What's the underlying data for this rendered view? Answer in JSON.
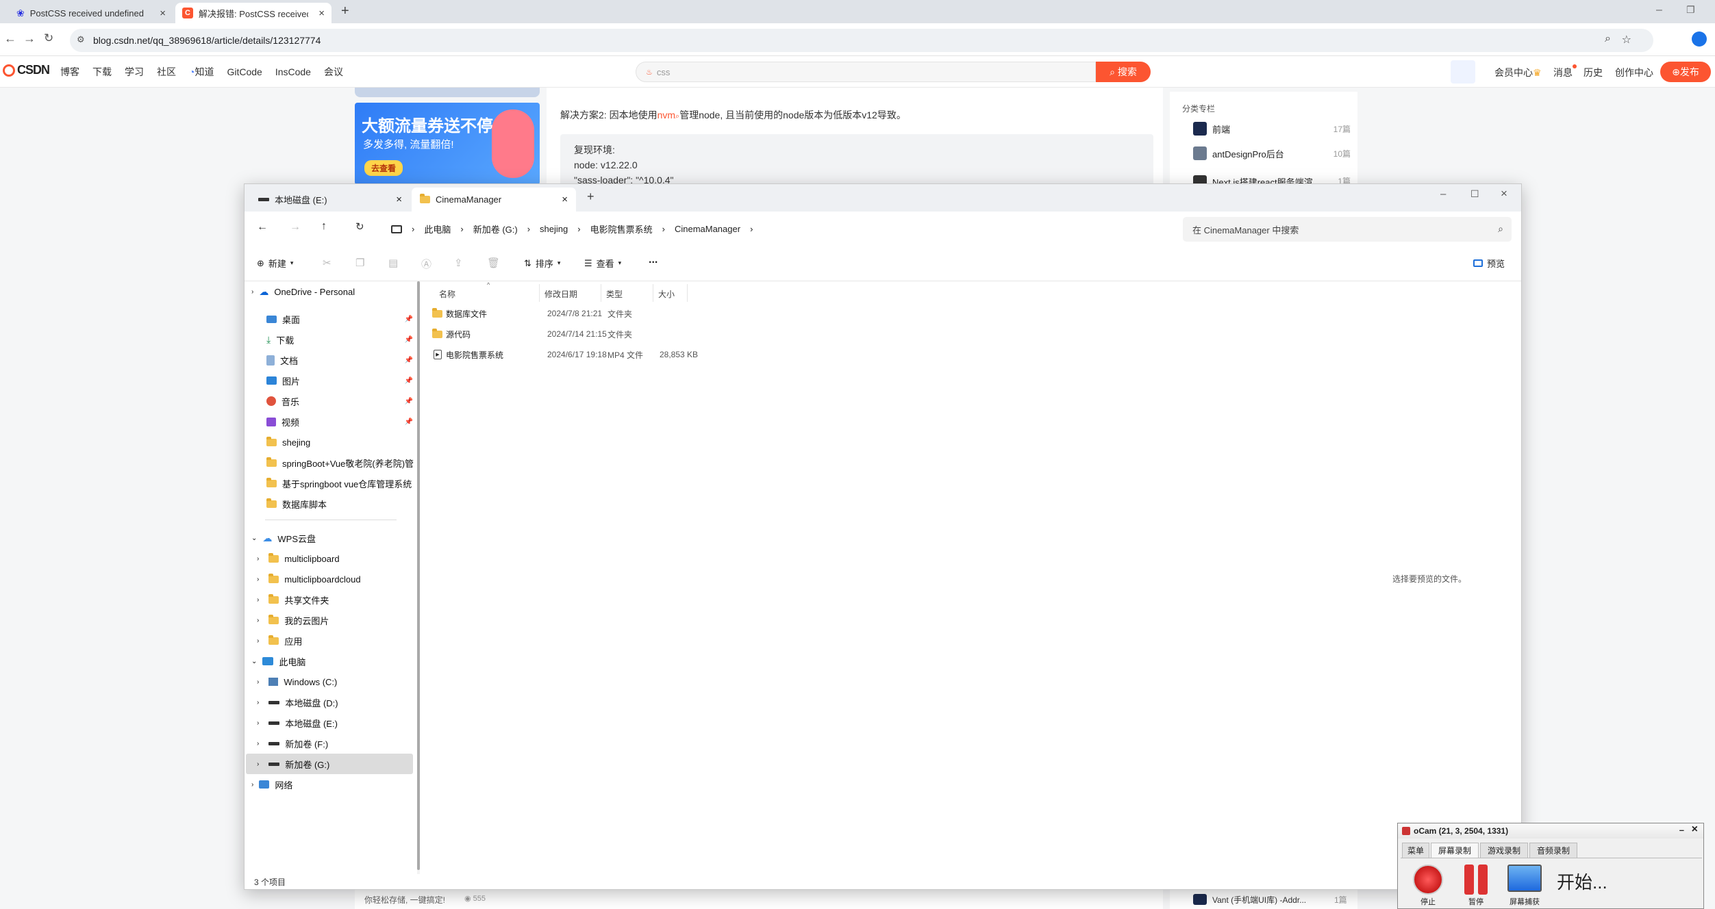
{
  "browser": {
    "tabs": [
      {
        "title": "PostCSS received undefined i",
        "active": false
      },
      {
        "title": "解决报错: PostCSS received u",
        "active": true
      }
    ],
    "url": "blog.csdn.net/qq_38969618/article/details/123127774"
  },
  "csdn": {
    "logo": "CSDN",
    "nav": [
      "博客",
      "下载",
      "学习",
      "社区",
      "知道",
      "GitCode",
      "InsCode",
      "会议"
    ],
    "search_placeholder": "css",
    "search_button": "搜索",
    "right_nav": [
      "会员中心",
      "消息",
      "历史",
      "创作中心"
    ],
    "publish": "发布"
  },
  "article": {
    "ad_title": "大额流量券送不停",
    "ad_subtitle": "多发多得, 流量翻倍!",
    "ad_button": "去查看",
    "solution_prefix": "解决方案2: 因本地使用",
    "solution_link": "nvm",
    "solution_suffix": "管理node, 且当前使用的node版本为低版本v12导致。",
    "code_lines": [
      "复现环境:",
      "node: v12.22.0",
      "\"sass-loader\": \"^10.0.4\""
    ],
    "bottom_text": "你轻松存储, 一键搞定!",
    "bottom_count": "555"
  },
  "column": {
    "title": "分类专栏",
    "items": [
      {
        "name": "前端",
        "count": "17篇"
      },
      {
        "name": "antDesignPro后台",
        "count": "10篇"
      },
      {
        "name": "Next.js搭建react服务端渲",
        "count": "1篇"
      }
    ],
    "bottom_item": {
      "name": "Vant (手机端UI库) -Addr...",
      "count": "1篇"
    }
  },
  "explorer": {
    "tabs": [
      {
        "title": "本地磁盘 (E:)",
        "active": false
      },
      {
        "title": "CinemaManager",
        "active": true
      }
    ],
    "breadcrumb": [
      "此电脑",
      "新加卷 (G:)",
      "shejing",
      "电影院售票系统",
      "CinemaManager"
    ],
    "search_placeholder": "在 CinemaManager 中搜索",
    "toolbar": {
      "new": "新建",
      "sort": "排序",
      "view": "查看",
      "more": "...",
      "preview": "预览"
    },
    "sidebar": {
      "onedrive": "OneDrive - Personal",
      "quick": [
        {
          "label": "桌面",
          "icon": "desktop-icon"
        },
        {
          "label": "下载",
          "icon": "download-icon"
        },
        {
          "label": "文档",
          "icon": "document-icon"
        },
        {
          "label": "图片",
          "icon": "picture-icon"
        },
        {
          "label": "音乐",
          "icon": "music-icon"
        },
        {
          "label": "视频",
          "icon": "video-icon"
        }
      ],
      "folders": [
        "shejing",
        "springBoot+Vue敬老院(养老院)管",
        "基于springboot vue仓库管理系统",
        "数据库脚本"
      ],
      "wps": "WPS云盘",
      "wps_items": [
        "multiclipboard",
        "multiclipboardcloud",
        "共享文件夹",
        "我的云图片",
        "应用"
      ],
      "pc": "此电脑",
      "drives": [
        "Windows (C:)",
        "本地磁盘 (D:)",
        "本地磁盘 (E:)",
        "新加卷 (F:)",
        "新加卷 (G:)"
      ],
      "network": "网络"
    },
    "columns": [
      "名称",
      "修改日期",
      "类型",
      "大小"
    ],
    "files": [
      {
        "name": "数据库文件",
        "date": "2024/7/8 21:21",
        "type": "文件夹",
        "size": "",
        "kind": "folder"
      },
      {
        "name": "源代码",
        "date": "2024/7/14 21:15",
        "type": "文件夹",
        "size": "",
        "kind": "folder"
      },
      {
        "name": "电影院售票系统",
        "date": "2024/6/17 19:18",
        "type": "MP4 文件",
        "size": "28,853 KB",
        "kind": "video"
      }
    ],
    "preview_hint": "选择要预览的文件。",
    "status": "3 个项目"
  },
  "ocam": {
    "title": "oCam (21, 3, 2504, 1331)",
    "tabs": [
      "菜单",
      "屏幕录制",
      "游戏录制",
      "音频录制"
    ],
    "buttons": [
      "停止",
      "暂停",
      "屏幕捕获"
    ],
    "status": "开始..."
  }
}
